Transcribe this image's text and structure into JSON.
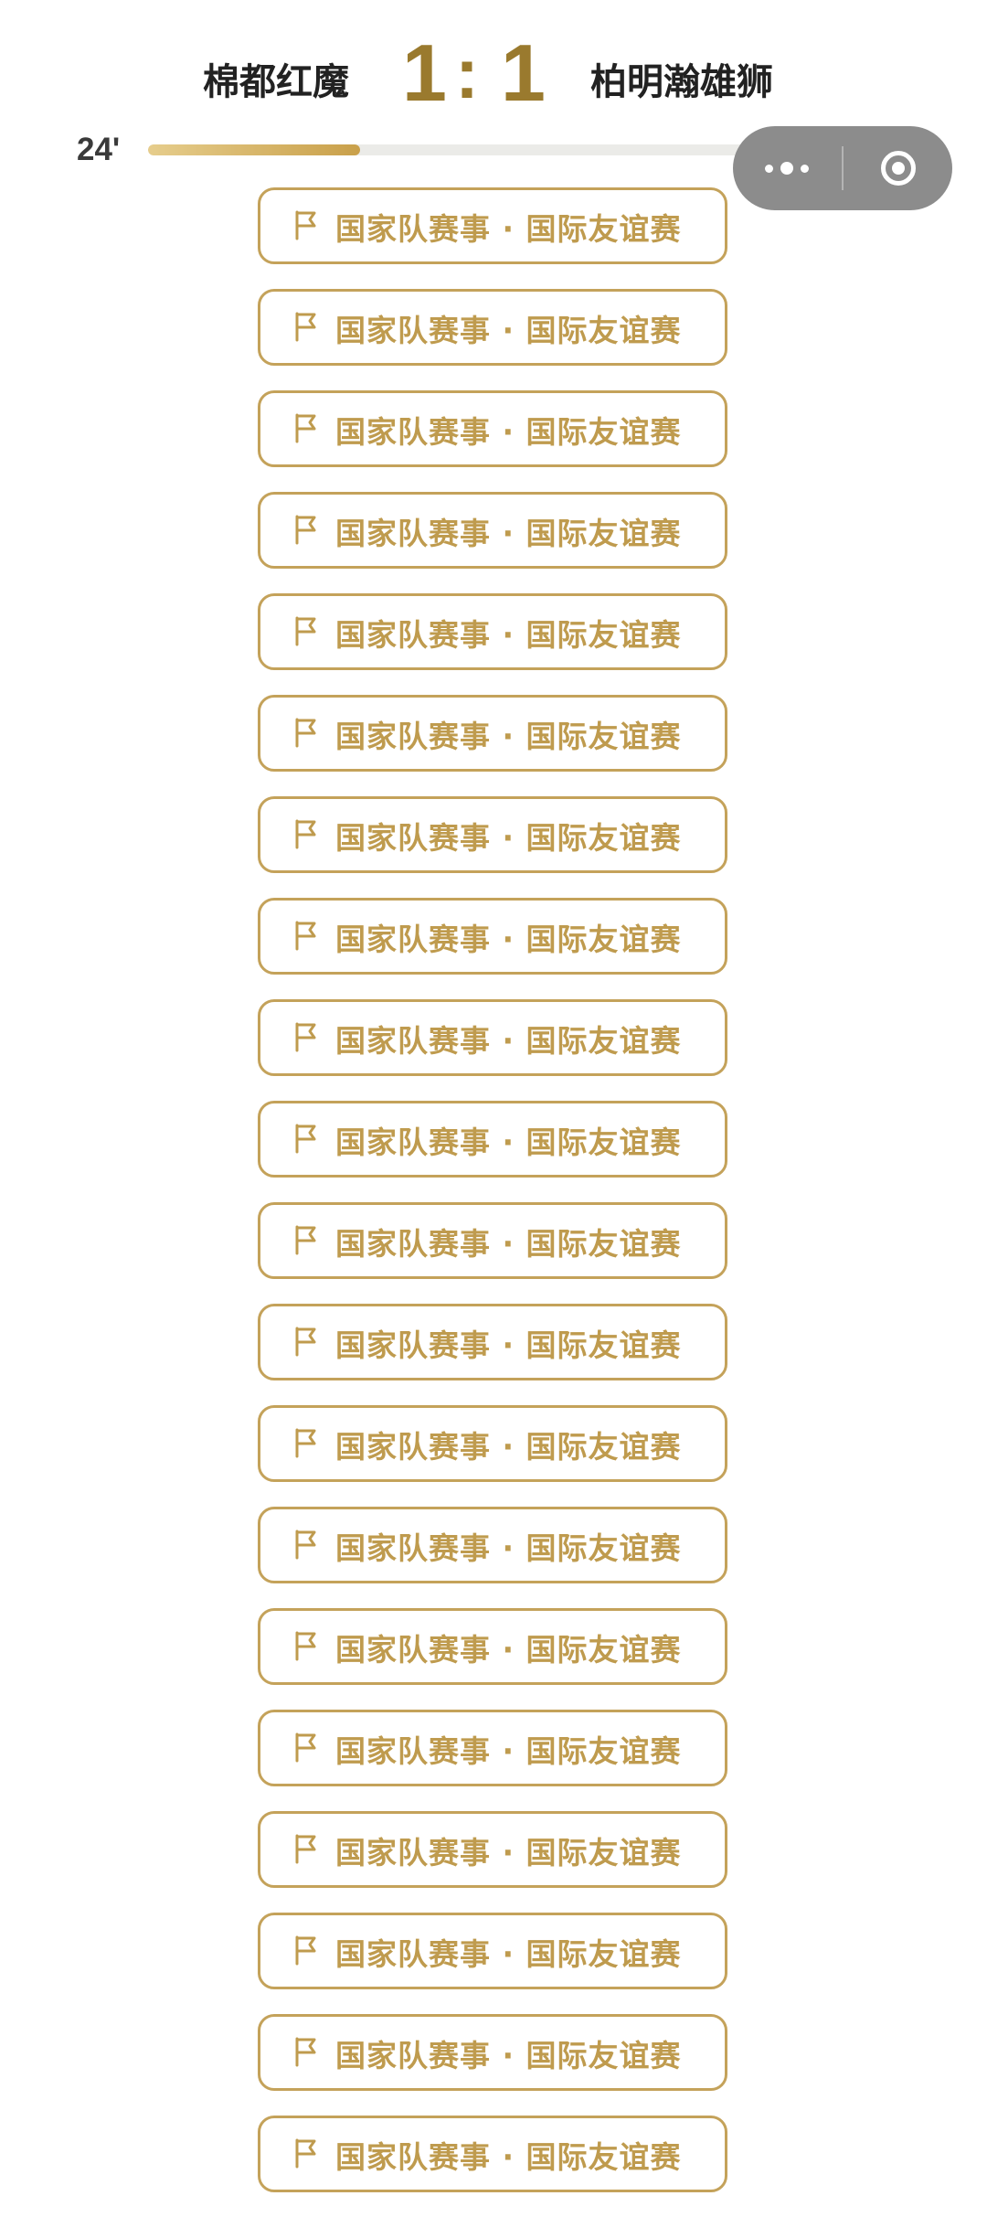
{
  "match": {
    "home_team": "棉都红魔",
    "away_team": "柏明瀚雄狮",
    "home_score": "1",
    "separator": ":",
    "away_score": "1",
    "minute": "24'",
    "progress_fraction": 0.27
  },
  "capsule": {
    "more_icon": "more-dots-icon",
    "close_icon": "target-ring-icon"
  },
  "colors": {
    "accent_gold": "#c4a25a",
    "score_gold": "#9a7a2e",
    "capsule_gray": "#8c8c8c"
  },
  "events": [
    {
      "icon": "flag-icon",
      "label": "国家队赛事 · 国际友谊赛"
    },
    {
      "icon": "flag-icon",
      "label": "国家队赛事 · 国际友谊赛"
    },
    {
      "icon": "flag-icon",
      "label": "国家队赛事 · 国际友谊赛"
    },
    {
      "icon": "flag-icon",
      "label": "国家队赛事 · 国际友谊赛"
    },
    {
      "icon": "flag-icon",
      "label": "国家队赛事 · 国际友谊赛"
    },
    {
      "icon": "flag-icon",
      "label": "国家队赛事 · 国际友谊赛"
    },
    {
      "icon": "flag-icon",
      "label": "国家队赛事 · 国际友谊赛"
    },
    {
      "icon": "flag-icon",
      "label": "国家队赛事 · 国际友谊赛"
    },
    {
      "icon": "flag-icon",
      "label": "国家队赛事 · 国际友谊赛"
    },
    {
      "icon": "flag-icon",
      "label": "国家队赛事 · 国际友谊赛"
    },
    {
      "icon": "flag-icon",
      "label": "国家队赛事 · 国际友谊赛"
    },
    {
      "icon": "flag-icon",
      "label": "国家队赛事 · 国际友谊赛"
    },
    {
      "icon": "flag-icon",
      "label": "国家队赛事 · 国际友谊赛"
    },
    {
      "icon": "flag-icon",
      "label": "国家队赛事 · 国际友谊赛"
    },
    {
      "icon": "flag-icon",
      "label": "国家队赛事 · 国际友谊赛"
    },
    {
      "icon": "flag-icon",
      "label": "国家队赛事 · 国际友谊赛"
    },
    {
      "icon": "flag-icon",
      "label": "国家队赛事 · 国际友谊赛"
    },
    {
      "icon": "flag-icon",
      "label": "国家队赛事 · 国际友谊赛"
    },
    {
      "icon": "flag-icon",
      "label": "国家队赛事 · 国际友谊赛"
    },
    {
      "icon": "flag-icon",
      "label": "国家队赛事 · 国际友谊赛"
    }
  ]
}
